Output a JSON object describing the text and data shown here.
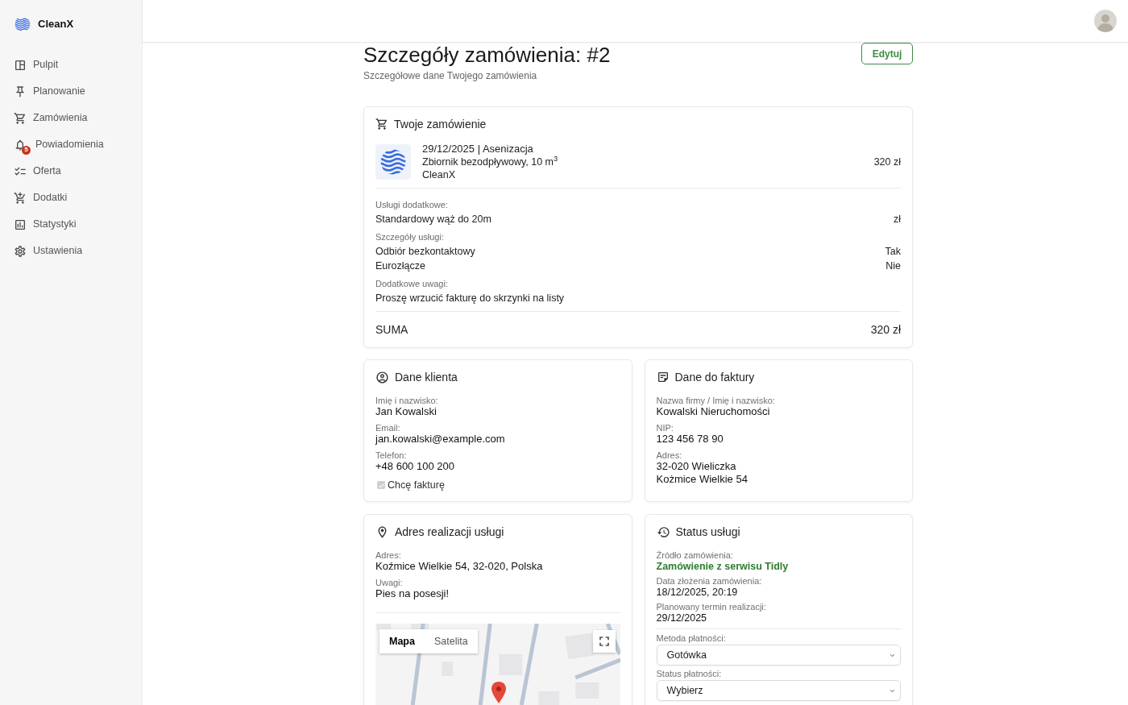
{
  "sidebar": {
    "brand": "CleanX",
    "items": [
      {
        "label": "Pulpit",
        "selected": false
      },
      {
        "label": "Planowanie",
        "selected": false
      },
      {
        "label": "Zamówienia",
        "selected": false
      },
      {
        "label": "Powiadomienia",
        "selected": false,
        "badge": "5"
      },
      {
        "label": "Oferta",
        "selected": false
      },
      {
        "label": "Dodatki",
        "selected": false
      },
      {
        "label": "Statystyki",
        "selected": false
      },
      {
        "label": "Ustawienia",
        "selected": false
      }
    ]
  },
  "page": {
    "title": "Szczegóły zamówienia: #2",
    "subtitle": "Szczegółowe dane Twojego zamówienia",
    "edit_button": "Edytuj"
  },
  "order": {
    "title": "Twoje zamówienie",
    "item": {
      "line_1": "29/12/2025 | Asenizacja",
      "line_2": "Zbiornik bezodpływowy, 10 m$^{3}$",
      "line_3": "CleanX",
      "price": "320 zł"
    },
    "sections": [
      {
        "label": "Usługi dodatkowe:",
        "rows": [
          {
            "name": "Standardowy wąż do 20m",
            "value": "zł"
          }
        ]
      },
      {
        "label": "Szczegóły usługi:",
        "rows": [
          {
            "name": "Odbiór bezkontaktowy",
            "value": "Tak"
          },
          {
            "name": "Eurozłącze",
            "value": "Nie"
          }
        ]
      },
      {
        "label": "Dodatkowe uwagi:",
        "rows": [
          {
            "name": "Proszę wrzucić fakturę do skrzynki na listy"
          }
        ]
      }
    ],
    "total": {
      "label": "SUMA",
      "value": "320 zł"
    }
  },
  "client": {
    "title": "Dane klienta",
    "fields": [
      {
        "label": "Imię i nazwisko:",
        "value": "Jan Kowalski"
      },
      {
        "label": "Email:",
        "value": "jan.kowalski@example.com"
      },
      {
        "label": "Telefon:",
        "value": "+48 600 100 200"
      }
    ],
    "invoice_checkbox": {
      "label": "Chcę fakturę",
      "checked": true,
      "disabled": true
    }
  },
  "invoice": {
    "title": "Dane do faktury",
    "fields": [
      {
        "label": "Nazwa firmy / Imię i nazwisko:",
        "value": "Kowalski Nieruchomości"
      },
      {
        "label": "NIP:",
        "value": "123 456 78 90"
      },
      {
        "label": "Adres:",
        "lines": [
          "32-020 Wieliczka",
          "Kożmice Wielkie 54"
        ]
      }
    ]
  },
  "address": {
    "title": "Adres realizacji usługi",
    "fields": [
      {
        "label": "Adres:",
        "value": "Koźmice Wielkie 54, 32-020, Polska"
      },
      {
        "label": "Uwagi:",
        "value": "Pies na posesji!"
      }
    ],
    "map": {
      "types": [
        {
          "label": "Mapa",
          "selected": true
        },
        {
          "label": "Satelita",
          "selected": false
        }
      ]
    }
  },
  "status": {
    "title": "Status usługi",
    "fields": [
      {
        "label": "Źródło zamówienia:",
        "value": "Zamówienie z serwisu Tidly",
        "kind": "link"
      },
      {
        "label": "Data złożenia zamówienia:",
        "value": "18/12/2025, 20:19",
        "kind": "text"
      },
      {
        "label": "Planowany termin realizacji:",
        "value": "29/12/2025",
        "kind": "text"
      }
    ],
    "selects": [
      {
        "label": "Metoda płatności:",
        "value": "Gotówka"
      },
      {
        "label": "Status płatności:",
        "value": "Wybierz"
      }
    ]
  }
}
